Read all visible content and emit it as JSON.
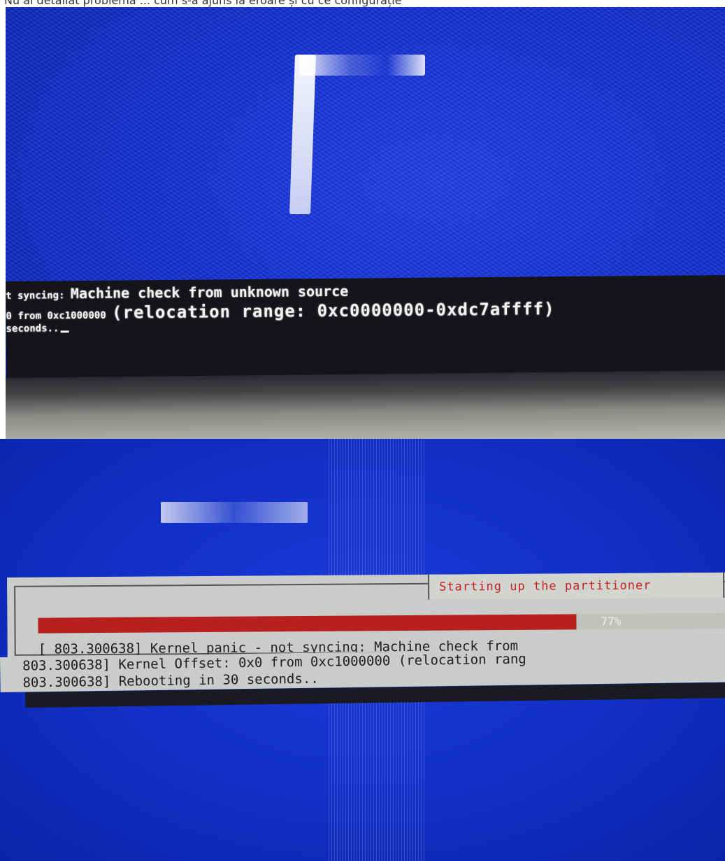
{
  "caption": "Nu ai detaliat problema ... cum s-a ajuns la eroare și cu ce configurație",
  "photo_top": {
    "console_lines": [
      {
        "prefix": "t syncing: ",
        "main": "Machine check from unknown source"
      },
      {
        "prefix": "0 from 0xc1000000 ",
        "main": "(relocation range: 0xc0000000-0xdc7affff)"
      },
      {
        "prefix": "seconds..",
        "main": ""
      }
    ]
  },
  "photo_bottom": {
    "dialog_title": "Starting up the partitioner",
    "progress": {
      "percent": 77,
      "label": "77%"
    },
    "log_lines": [
      "[   803.300638] Kernel panic - not syncing: Machine check from",
      "803.300638] Kernel Offset: 0x0 from 0xc1000000 (relocation rang",
      "803.300638] Rebooting in 30 seconds.."
    ]
  },
  "colors": {
    "screen_blue": "#1431d6",
    "console_bg": "#141419",
    "dialog_bg": "#c9ccc8",
    "accent_red": "#b81f1f"
  }
}
